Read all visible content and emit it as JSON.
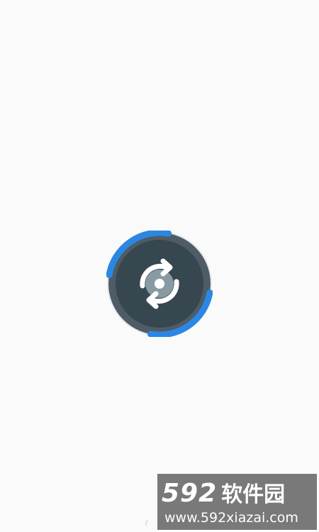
{
  "app": {
    "splash_icon": "sync-rotate-icon",
    "colors": {
      "background": "#fafafa",
      "ring_dark": "#4e5c66",
      "ring_accent": "#2b87e3",
      "core": "#37474f",
      "glyph": "#ffffff",
      "disc": "#8a9aa3"
    }
  },
  "watermark": {
    "number": "592",
    "chinese": "软件园",
    "url": "www.592xiazai.com"
  }
}
